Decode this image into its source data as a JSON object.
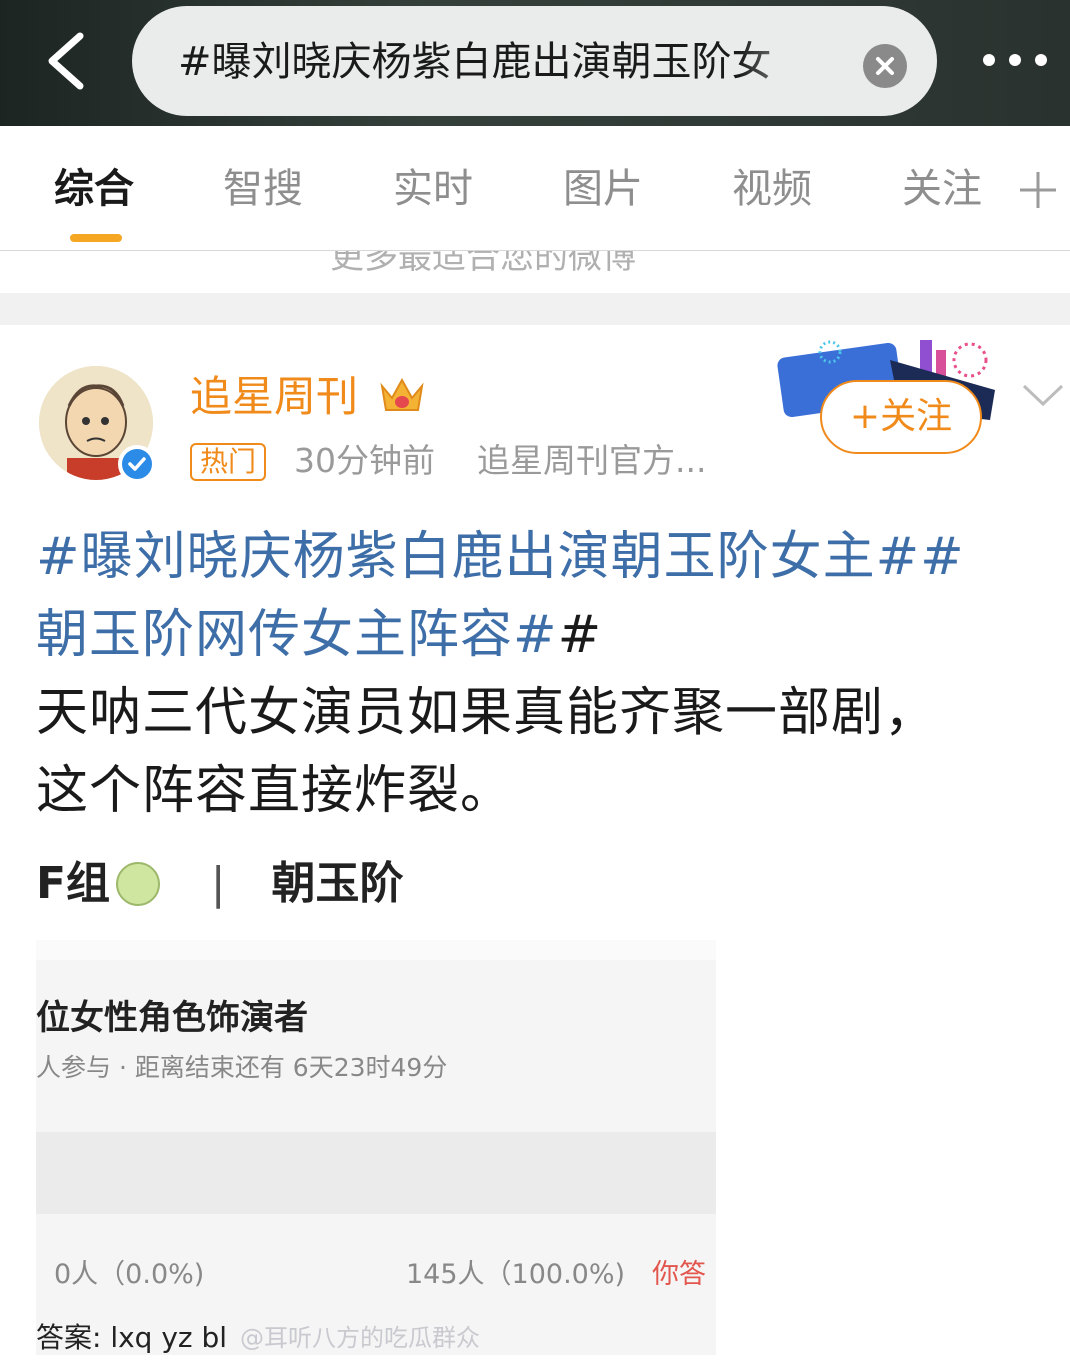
{
  "search": {
    "query": "#曝刘晓庆杨紫白鹿出演朝玉阶女"
  },
  "tabs": [
    {
      "label": "综合",
      "active": true
    },
    {
      "label": "智搜",
      "active": false
    },
    {
      "label": "实时",
      "active": false
    },
    {
      "label": "图片",
      "active": false
    },
    {
      "label": "视频",
      "active": false
    },
    {
      "label": "关注",
      "active": false
    }
  ],
  "peek_text": "更多最适合您的微博",
  "post": {
    "author": "追星周刊",
    "badge": "热门",
    "time": "30分钟前",
    "source": "追星周刊官方...",
    "follow_label": "+关注",
    "topic_1": "#曝刘晓庆杨紫白鹿出演朝玉阶女主#",
    "topic_2_a": "#",
    "topic_2_b": "朝玉阶网传女主阵容#",
    "topic_2_hash": "#",
    "body_1": " 天呐三代女演员如果真能齐聚一部剧，",
    "body_2": "这个阵容直接炸裂。"
  },
  "embedded": {
    "title_left": "F组",
    "title_sep": "|",
    "title_right": "朝玉阶",
    "question": "位女性角色饰演者",
    "sub": "人参与 · 距离结束还有 6天23时49分",
    "opt_a": "0人（0.0%)",
    "opt_b": "145人（100.0%)",
    "opt_c": "你答",
    "answer": "答案: lxq yz bl",
    "watermark": "@耳听八方的吃瓜群众"
  },
  "colors": {
    "accent": "#f08a1a",
    "topic": "#3e6ea8",
    "underline": "#f5a623",
    "verified": "#2d8be8"
  }
}
